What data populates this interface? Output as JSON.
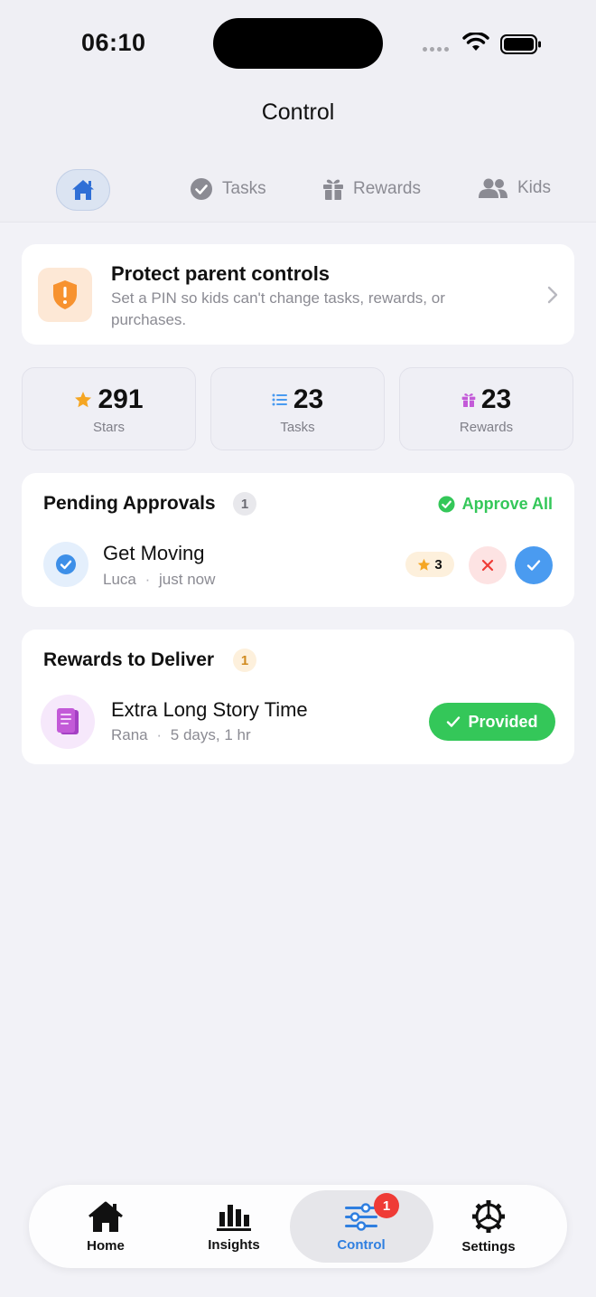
{
  "status_bar": {
    "time": "06:10"
  },
  "header": {
    "title": "Control"
  },
  "segments": {
    "home_icon": "house-icon",
    "tasks_label": "Tasks",
    "rewards_label": "Rewards",
    "kids_label": "Kids"
  },
  "protect": {
    "title": "Protect parent controls",
    "description": "Set a PIN so kids can't change tasks, rewards, or purchases."
  },
  "stats": [
    {
      "value": "291",
      "label": "Stars",
      "icon": "star-icon"
    },
    {
      "value": "23",
      "label": "Tasks",
      "icon": "list-icon"
    },
    {
      "value": "23",
      "label": "Rewards",
      "icon": "gift-icon"
    }
  ],
  "pending": {
    "title": "Pending Approvals",
    "count": "1",
    "approve_all": "Approve All",
    "items": [
      {
        "title": "Get Moving",
        "kid": "Luca",
        "time": "just now",
        "stars": "3"
      }
    ]
  },
  "deliver": {
    "title": "Rewards to Deliver",
    "count": "1",
    "items": [
      {
        "title": "Extra Long Story Time",
        "kid": "Rana",
        "time": "5 days, 1 hr",
        "action": "Provided"
      }
    ]
  },
  "tabbar": {
    "home": "Home",
    "insights": "Insights",
    "control": "Control",
    "control_badge": "1",
    "settings": "Settings"
  },
  "colors": {
    "accent": "#4a9bf0",
    "success": "#34c759",
    "star": "#f5a623",
    "danger": "#ef3b36",
    "reward": "#c35ad8",
    "warning": "#f7922f"
  }
}
